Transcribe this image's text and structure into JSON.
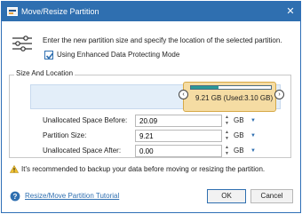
{
  "window": {
    "title": "Move/Resize Partition",
    "close_glyph": "✕"
  },
  "intro": {
    "text": "Enter the new partition size and specify the location of the selected partition.",
    "icon": "sliders-icon"
  },
  "enhanced_mode": {
    "label": "Using Enhanced Data Protecting Mode",
    "checked": true
  },
  "size_location": {
    "group_label": "Size And Location",
    "partition_label": "9.21 GB (Used:3.10 GB)",
    "used_fraction": 0.34,
    "left_arrow": "‹",
    "right_arrow": "›"
  },
  "fields": {
    "before": {
      "label": "Unallocated Space Before:",
      "value": "20.09",
      "unit": "GB"
    },
    "size": {
      "label": "Partition Size:",
      "value": "9.21",
      "unit": "GB"
    },
    "after": {
      "label": "Unallocated Space After:",
      "value": "0.00",
      "unit": "GB"
    }
  },
  "warning": {
    "text": "It's recommended to backup your data before moving or resizing the partition."
  },
  "footer": {
    "tutorial_link": "Resize/Move Partition Tutorial",
    "ok_label": "OK",
    "cancel_label": "Cancel"
  },
  "colors": {
    "accent": "#2f6fb0",
    "track": "#e3eef9",
    "partition": "#f5dca3",
    "used": "#2a9898"
  }
}
